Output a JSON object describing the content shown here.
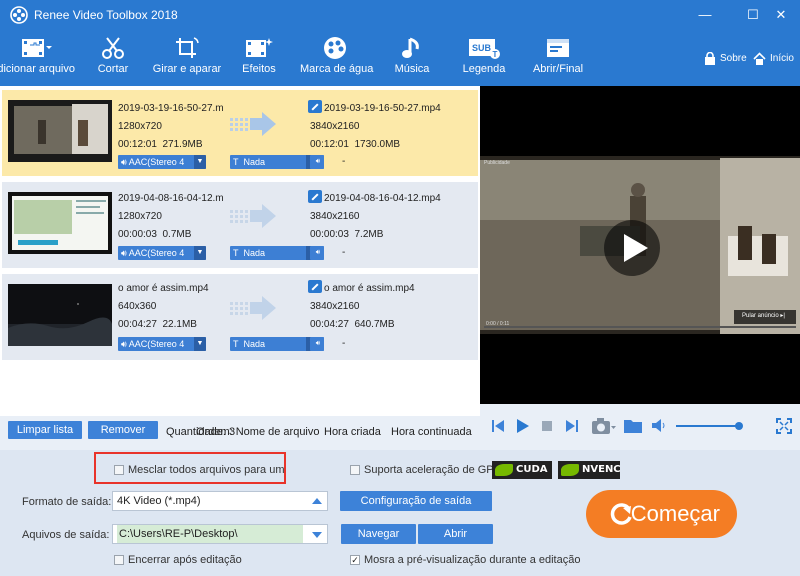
{
  "app": {
    "title": "Renee Video Toolbox 2018"
  },
  "window_controls": {
    "minimize": "—",
    "maximize": "☐",
    "close": "✕"
  },
  "toolbar": {
    "items": [
      {
        "label": "Adicionar arquivo",
        "icon": "film-add-icon"
      },
      {
        "label": "Cortar",
        "icon": "scissors-icon"
      },
      {
        "label": "Girar e aparar",
        "icon": "crop-rotate-icon"
      },
      {
        "label": "Efeitos",
        "icon": "film-sparkle-icon"
      },
      {
        "label": "Marca de água",
        "icon": "watermark-icon"
      },
      {
        "label": "Música",
        "icon": "music-note-icon"
      },
      {
        "label": "Legenda",
        "icon": "subtitle-icon"
      },
      {
        "label": "Abrir/Final",
        "icon": "intro-outro-icon"
      }
    ],
    "sobre": "Sobre",
    "inicio": "Início"
  },
  "files": [
    {
      "src_name": "2019-03-19-16-50-27.m",
      "src_res": "1280x720",
      "src_dur": "00:12:01",
      "src_size": "271.9MB",
      "out_name": "2019-03-19-16-50-27.mp4",
      "out_res": "3840x2160",
      "out_dur": "00:12:01",
      "out_size": "1730.0MB",
      "audio": "AAC(Stereo 4",
      "subtitle": "Nada",
      "dash": "-"
    },
    {
      "src_name": "2019-04-08-16-04-12.m",
      "src_res": "1280x720",
      "src_dur": "00:00:03",
      "src_size": "0.7MB",
      "out_name": "2019-04-08-16-04-12.mp4",
      "out_res": "3840x2160",
      "out_dur": "00:00:03",
      "out_size": "7.2MB",
      "audio": "AAC(Stereo 4",
      "subtitle": "Nada",
      "dash": "-"
    },
    {
      "src_name": "o amor é assim.mp4",
      "src_res": "640x360",
      "src_dur": "00:04:27",
      "src_size": "22.1MB",
      "out_name": "o amor é assim.mp4",
      "out_res": "3840x2160",
      "out_dur": "00:04:27",
      "out_size": "640.7MB",
      "audio": "AAC(Stereo 4",
      "subtitle": "Nada",
      "dash": "-"
    }
  ],
  "preview": {
    "tag": "Publicidade",
    "skip_ad": "Pular anúncio ▸|",
    "progress_text": "0:00 / 0:11"
  },
  "list_controls": {
    "clear": "Limpar lista",
    "remove": "Remover",
    "quantity": "Quantidade: 3",
    "order": "Ordem: Nome de arquivo",
    "hora_criada": "Hora criada",
    "hora_continuada": "Hora continuada"
  },
  "settings": {
    "merge_label": "Mesclar todos arquivos para um",
    "gpu_label": "Suporta aceleração de GPU",
    "cuda": "CUDA",
    "nvenc": "NVENC",
    "format_label": "Formato de saída:",
    "format_value": "4K Video (*.mp4)",
    "format_config": "Configuração de saída",
    "output_label": "Aquivos de saída:",
    "output_value": "C:\\Users\\RE-P\\Desktop\\",
    "browse": "Navegar",
    "open": "Abrir",
    "close_after": "Encerrar após editação",
    "show_preview": "Mosra a pré-visualização durante a editação",
    "start": "Começar"
  },
  "colors": {
    "accent": "#2a79d0",
    "selected_row": "#fce9a9",
    "start": "#f47d24",
    "highlight": "#e8332a"
  }
}
